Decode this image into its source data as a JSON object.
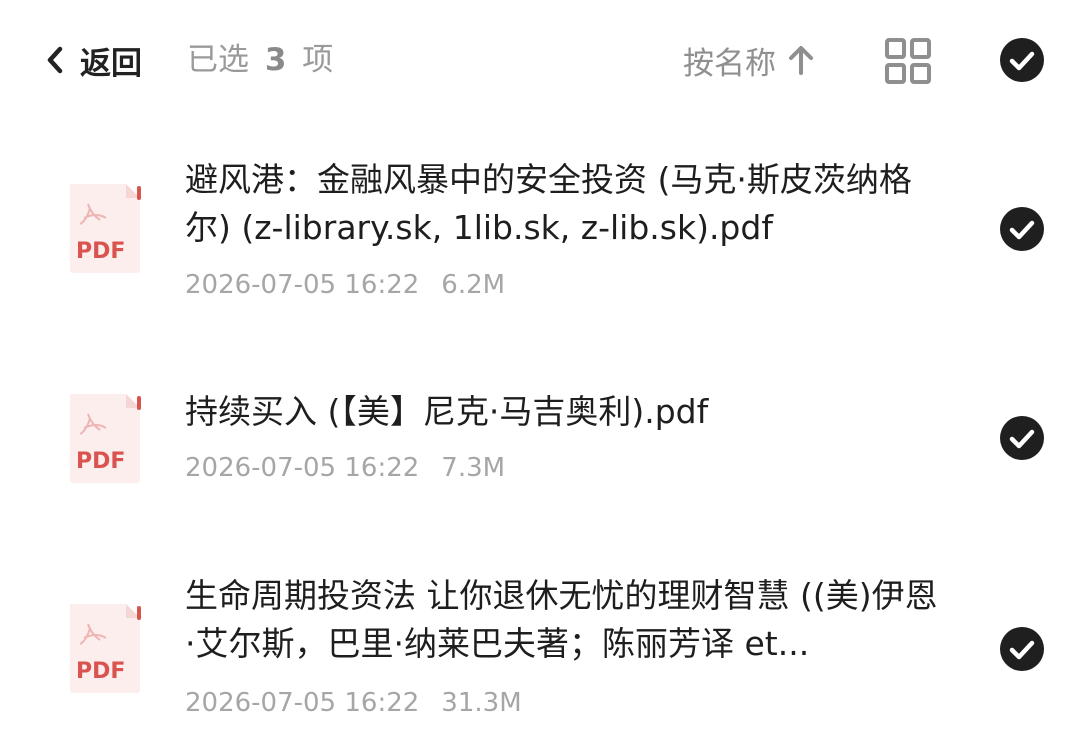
{
  "header": {
    "back_label": "返回",
    "selected_prefix": "已选",
    "selected_count": "3",
    "selected_suffix": "项",
    "sort_label": "按名称",
    "sort_direction": "ascending",
    "all_selected": true
  },
  "colors": {
    "check_fill": "#1f1f1f",
    "pdf_red": "#d9534f",
    "pdf_bg": "#fdeeee",
    "meta_gray": "#a6a6a6"
  },
  "files": [
    {
      "icon": "pdf-icon",
      "icon_label": "PDF",
      "name": "避风港：金融风暴中的安全投资 (马克·斯皮茨纳格尔) (z-library.sk, 1lib.sk, z-lib.sk).pdf",
      "date": "2026-07-05 16:22",
      "size": "6.2M",
      "selected": true
    },
    {
      "icon": "pdf-icon",
      "icon_label": "PDF",
      "name": "持续买入 (【美】尼克·马吉奥利).pdf",
      "date": "2026-07-05 16:22",
      "size": "7.3M",
      "selected": true
    },
    {
      "icon": "pdf-icon",
      "icon_label": "PDF",
      "name": "生命周期投资法 让你退休无忧的理财智慧 ((美)伊恩·艾尔斯，巴里·纳莱巴夫著；陈丽芳译 et...",
      "date": "2026-07-05 16:22",
      "size": "31.3M",
      "selected": true
    }
  ]
}
